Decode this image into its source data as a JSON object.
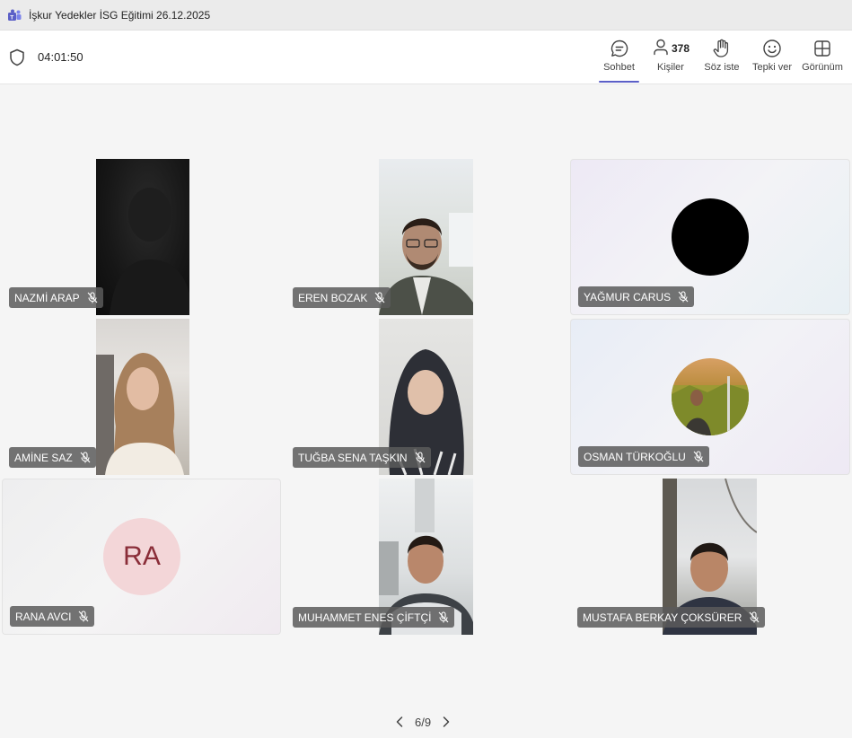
{
  "window": {
    "title": "İşkur Yedekler İSG Eğitimi 26.12.2025",
    "app_icon": "teams-icon"
  },
  "toolbar": {
    "timer": "04:01:50",
    "buttons": [
      {
        "label": "Sohbet",
        "icon": "chat-icon",
        "active": true
      },
      {
        "label": "Kişiler",
        "icon": "people-icon",
        "count": "378"
      },
      {
        "label": "Söz iste",
        "icon": "raise-hand-icon"
      },
      {
        "label": "Tepki ver",
        "icon": "react-icon"
      },
      {
        "label": "Görünüm",
        "icon": "view-icon"
      }
    ]
  },
  "participants": [
    {
      "name": "NAZMİ ARAP",
      "muted": true,
      "media": "video"
    },
    {
      "name": "EREN BOZAK",
      "muted": true,
      "media": "video"
    },
    {
      "name": "YAĞMUR CARUS",
      "muted": true,
      "media": "avatar"
    },
    {
      "name": "AMİNE SAZ",
      "muted": true,
      "media": "video"
    },
    {
      "name": "TUĞBA SENA TAŞKIN",
      "muted": true,
      "media": "video"
    },
    {
      "name": "OSMAN TÜRKOĞLU",
      "muted": true,
      "media": "avatar-photo"
    },
    {
      "name": "RANA AVCI",
      "muted": true,
      "media": "initials",
      "initials": "RA"
    },
    {
      "name": "MUHAMMET ENES ÇİFTÇİ",
      "muted": true,
      "media": "video"
    },
    {
      "name": "MUSTAFA BERKAY ÇOKSÜRER",
      "muted": true,
      "media": "video"
    }
  ],
  "pager": {
    "current": "6/9"
  },
  "colors": {
    "accent": "#5b5fc7",
    "badge_bg": "#5a5a5a",
    "initials_bg": "#f3d6d8",
    "initials_fg": "#8a2d38"
  }
}
